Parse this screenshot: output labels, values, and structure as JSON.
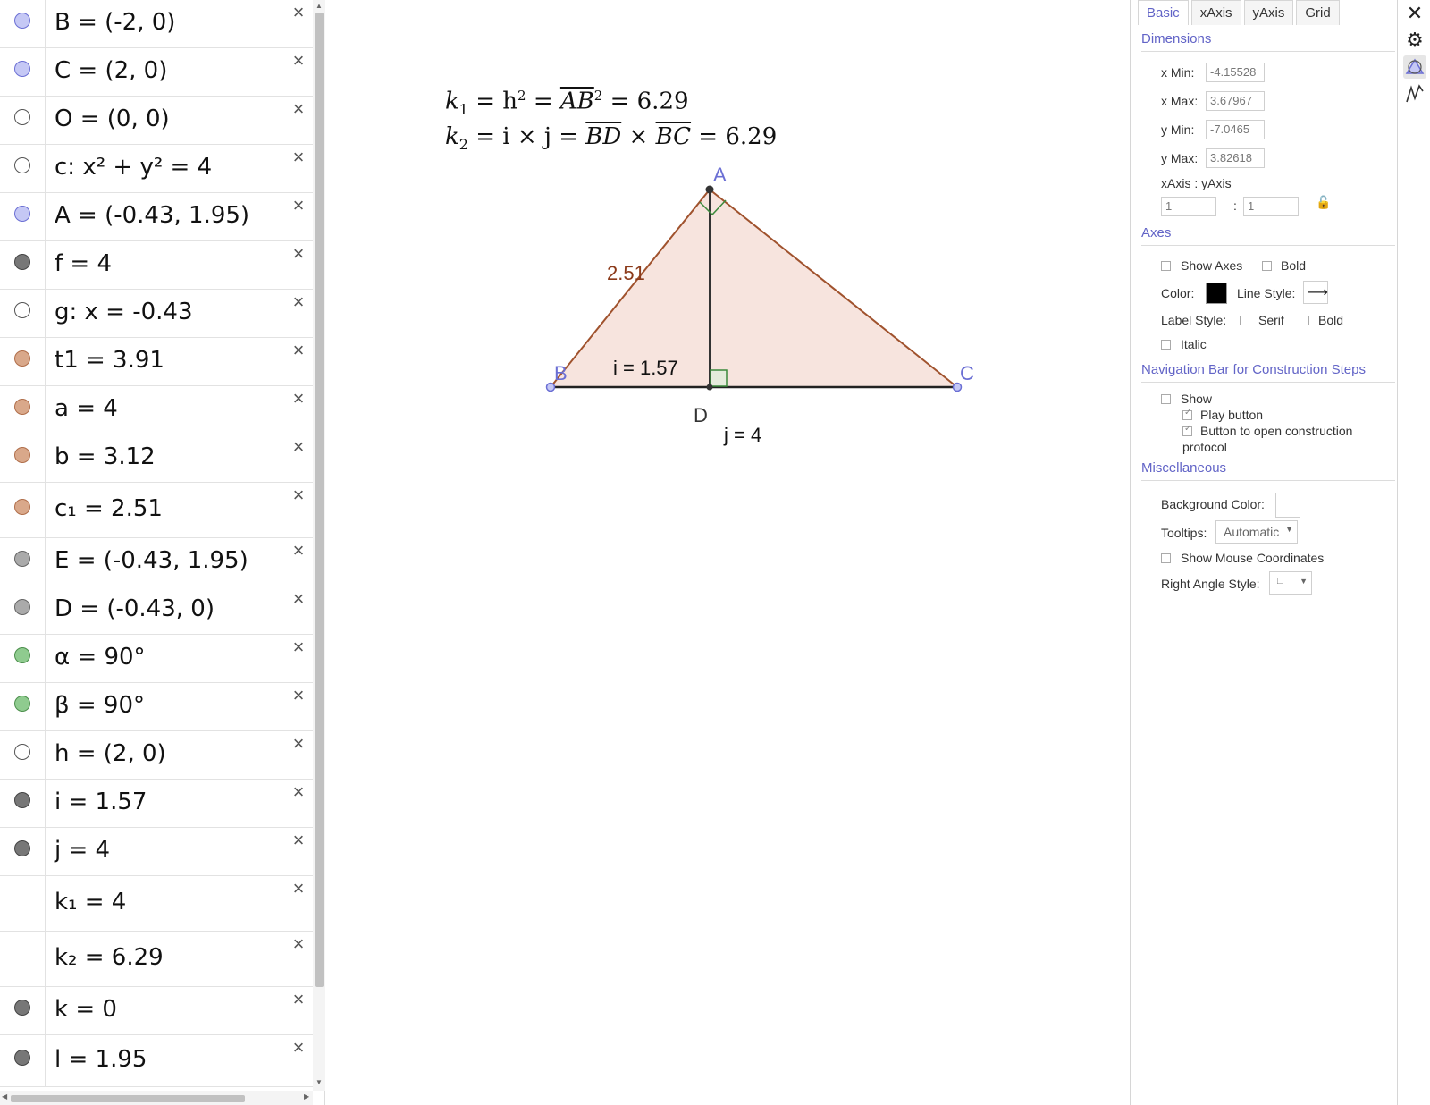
{
  "algebra": {
    "rows": [
      {
        "text": "B = (-2, 0)",
        "marble": "#c5c8f5",
        "border": "#6b6fd4",
        "h": 54
      },
      {
        "text": "C = (2, 0)",
        "marble": "#c5c8f5",
        "border": "#6b6fd4",
        "h": 54
      },
      {
        "text": "O = (0, 0)",
        "marble": "#ffffff",
        "border": "#555555",
        "h": 54
      },
      {
        "text": "c: x² + y² = 4",
        "marble": "#ffffff",
        "border": "#555555",
        "h": 54
      },
      {
        "text": "A = (-0.43, 1.95)",
        "marble": "#c5c8f5",
        "border": "#6b6fd4",
        "h": 54
      },
      {
        "text": "f = 4",
        "marble": "#777777",
        "border": "#444444",
        "h": 54
      },
      {
        "text": "g: x = -0.43",
        "marble": "#ffffff",
        "border": "#555555",
        "h": 54
      },
      {
        "text": "t1 = 3.91",
        "marble": "#d9a88a",
        "border": "#b06e4a",
        "h": 54
      },
      {
        "text": "a = 4",
        "marble": "#d9a88a",
        "border": "#b06e4a",
        "h": 54
      },
      {
        "text": "b = 3.12",
        "marble": "#d9a88a",
        "border": "#b06e4a",
        "h": 54
      },
      {
        "text": "c₁ = 2.51",
        "marble": "#d9a88a",
        "border": "#b06e4a",
        "h": 62
      },
      {
        "text": "E = (-0.43, 1.95)",
        "marble": "#aaaaaa",
        "border": "#666666",
        "h": 54
      },
      {
        "text": "D = (-0.43, 0)",
        "marble": "#aaaaaa",
        "border": "#666666",
        "h": 54
      },
      {
        "text": "α = 90°",
        "marble": "#8fcb8f",
        "border": "#4c8f4c",
        "h": 54
      },
      {
        "text": "β = 90°",
        "marble": "#8fcb8f",
        "border": "#4c8f4c",
        "h": 54
      },
      {
        "text": "h = (2, 0)",
        "marble": "#ffffff",
        "border": "#555555",
        "h": 54
      },
      {
        "text": "i = 1.57",
        "marble": "#777777",
        "border": "#444444",
        "h": 54
      },
      {
        "text": "j = 4",
        "marble": "#777777",
        "border": "#444444",
        "h": 54
      },
      {
        "text": "k₁ = 4",
        "marble": "",
        "border": "",
        "h": 62
      },
      {
        "text": "k₂ = 6.29",
        "marble": "",
        "border": "",
        "h": 62
      },
      {
        "text": "k = 0",
        "marble": "#777777",
        "border": "#444444",
        "h": 54
      },
      {
        "text": "l = 1.95",
        "marble": "#777777",
        "border": "#444444",
        "h": 58
      }
    ],
    "delete_glyph": "×"
  },
  "graphics": {
    "formula1": {
      "prefix": "k",
      "sub": "1",
      "mid": " = h",
      "sup": "2",
      "eq": " = ",
      "seg": "AB",
      "sup2": "2",
      "result": " = 6.29"
    },
    "formula2": {
      "prefix": "k",
      "sub": "2",
      "mid": " = i × j = ",
      "seg1": "BD",
      "times": " × ",
      "seg2": "BC",
      "result": " = 6.29"
    },
    "labels": {
      "A": "A",
      "B": "B",
      "C": "C",
      "D": "D",
      "c1_value": "2.51",
      "i_value": "i = 1.57",
      "j_value": "j = 4"
    },
    "colors": {
      "triangle_fill": "#f7e4de",
      "triangle_edge": "#a0522d",
      "altitude": "#333333",
      "right_angle": "#3c8a3c",
      "point": "#6b6fd4",
      "label_point": "#6b6fd4",
      "c1_label": "#8b3a1a"
    }
  },
  "settings": {
    "tabs": [
      "Basic",
      "xAxis",
      "yAxis",
      "Grid"
    ],
    "active_tab": "Basic",
    "dimensions": {
      "title": "Dimensions",
      "xmin_label": "x Min:",
      "xmin": "-4.15528",
      "xmax_label": "x Max:",
      "xmax": "3.67967",
      "ymin_label": "y Min:",
      "ymin": "-7.0465",
      "ymax_label": "y Max:",
      "ymax": "3.82618",
      "ratio_label": "xAxis : yAxis",
      "ratio_x": "1",
      "ratio_sep": ":",
      "ratio_y": "1"
    },
    "axes": {
      "title": "Axes",
      "show_axes": "Show Axes",
      "bold": "Bold",
      "color_label": "Color:",
      "color": "#000000",
      "line_style_label": "Line Style:",
      "line_style": "⟶",
      "label_style_label": "Label Style:",
      "serif": "Serif",
      "bold2": "Bold",
      "italic": "Italic"
    },
    "navbar": {
      "title": "Navigation Bar for Construction Steps",
      "show": "Show",
      "play": "Play button",
      "open_protocol_1": "Button to open construction",
      "open_protocol_2": "protocol"
    },
    "misc": {
      "title": "Miscellaneous",
      "bg_label": "Background Color:",
      "tooltips_label": "Tooltips:",
      "tooltips_value": "Automatic",
      "mouse_coords": "Show Mouse Coordinates",
      "right_angle_label": "Right Angle Style:",
      "right_angle_value": "□"
    }
  },
  "strip": {
    "close": "✕",
    "gear": "⚙"
  }
}
